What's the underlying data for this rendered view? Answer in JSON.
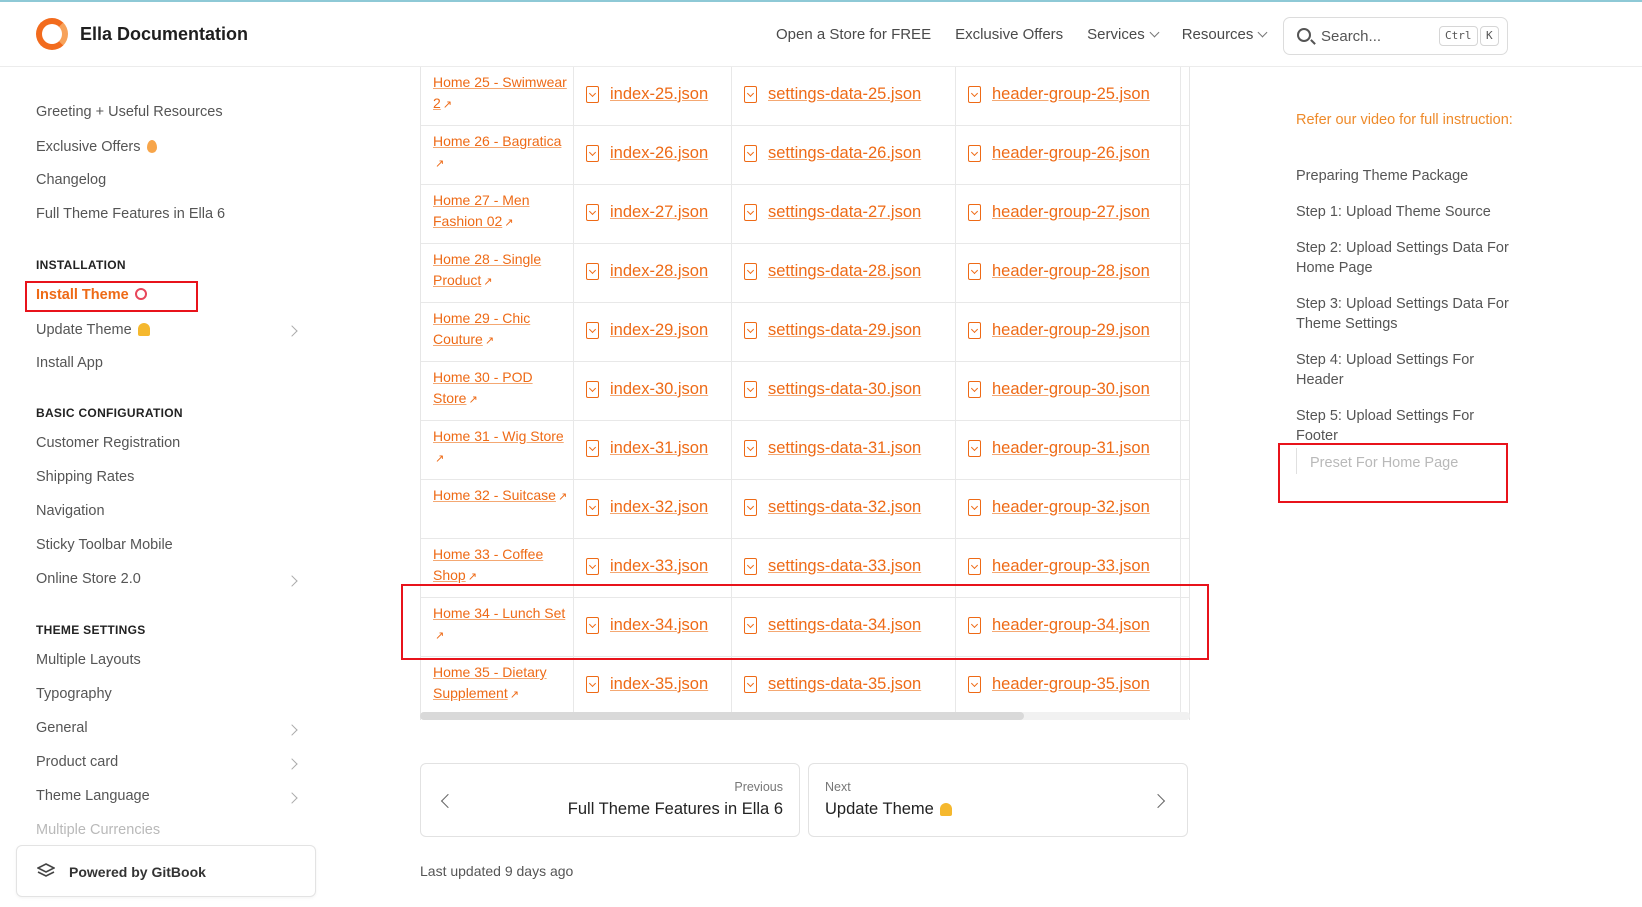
{
  "header": {
    "brand": "Ella Documentation",
    "nav": [
      "Open a Store for FREE",
      "Exclusive Offers",
      "Services",
      "Resources"
    ],
    "search_placeholder": "Search...",
    "kbd_ctrl": "Ctrl",
    "kbd_k": "K"
  },
  "sidebar": {
    "items_top": [
      "Greeting + Useful Resources",
      "Exclusive Offers",
      "Changelog",
      "Full Theme Features in Ella 6"
    ],
    "sec_installation": "INSTALLATION",
    "install_theme": "Install Theme",
    "update_theme": "Update Theme",
    "install_app": "Install App",
    "sec_basic": "BASIC CONFIGURATION",
    "basic_items": [
      "Customer Registration",
      "Shipping Rates",
      "Navigation",
      "Sticky Toolbar Mobile",
      "Online Store 2.0"
    ],
    "sec_theme": "THEME SETTINGS",
    "theme_items": [
      "Multiple Layouts",
      "Typography",
      "General",
      "Product card",
      "Theme Language",
      "Multiple Currencies"
    ],
    "powered": "Powered by GitBook"
  },
  "table": {
    "rows": [
      {
        "home": "Home 25 - Swimwear 2",
        "index": "index-25.json",
        "settings": "settings-data-25.json",
        "header": "header-group-25.json"
      },
      {
        "home": "Home 26 - Bagratica",
        "index": "index-26.json",
        "settings": "settings-data-26.json",
        "header": "header-group-26.json"
      },
      {
        "home": "Home 27 - Men Fashion 02",
        "index": "index-27.json",
        "settings": "settings-data-27.json",
        "header": "header-group-27.json"
      },
      {
        "home": "Home 28 - Single Product",
        "index": "index-28.json",
        "settings": "settings-data-28.json",
        "header": "header-group-28.json"
      },
      {
        "home": "Home 29 - Chic Couture",
        "index": "index-29.json",
        "settings": "settings-data-29.json",
        "header": "header-group-29.json"
      },
      {
        "home": "Home 30 - POD Store",
        "index": "index-30.json",
        "settings": "settings-data-30.json",
        "header": "header-group-30.json"
      },
      {
        "home": "Home 31 - Wig Store",
        "index": "index-31.json",
        "settings": "settings-data-31.json",
        "header": "header-group-31.json"
      },
      {
        "home": "Home 32 - Suitcase",
        "index": "index-32.json",
        "settings": "settings-data-32.json",
        "header": "header-group-32.json"
      },
      {
        "home": "Home 33 - Coffee Shop",
        "index": "index-33.json",
        "settings": "settings-data-33.json",
        "header": "header-group-33.json"
      },
      {
        "home": "Home 34 - Lunch Set",
        "index": "index-34.json",
        "settings": "settings-data-34.json",
        "header": "header-group-34.json"
      },
      {
        "home": "Home 35 - Dietary Supplement",
        "index": "index-35.json",
        "settings": "settings-data-35.json",
        "header": "header-group-35.json"
      }
    ]
  },
  "pager": {
    "prev_label": "Previous",
    "prev_title": "Full Theme Features in Ella 6",
    "next_label": "Next",
    "next_title": "Update Theme"
  },
  "last_updated": "Last updated 9 days ago",
  "toc": {
    "head": "Refer our video for full instruction:",
    "items": [
      "Preparing Theme Package",
      "Step 1: Upload Theme Source",
      "Step 2: Upload Settings Data For Home Page",
      "Step 3: Upload Settings Data For Theme Settings",
      "Step 4: Upload Settings For Header",
      "Step 5: Upload Settings For Footer"
    ],
    "sub": "Preset For Home Page"
  },
  "colors": {
    "accent": "#ee6a16",
    "highlight": "#e8131b"
  }
}
